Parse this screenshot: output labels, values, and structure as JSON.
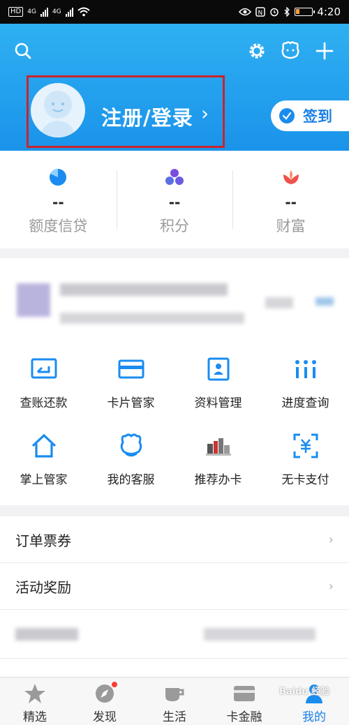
{
  "status_bar": {
    "hd": "HD",
    "net1": "4G",
    "net2": "4G",
    "time": "4:20"
  },
  "header": {
    "login_text": "注册/登录",
    "chevron": "›",
    "checkin_label": "签到"
  },
  "stats": [
    {
      "icon": "pie-icon",
      "value": "--",
      "label": "额度信贷"
    },
    {
      "icon": "three-circles-icon",
      "value": "--",
      "label": "积分"
    },
    {
      "icon": "lotus-icon",
      "value": "--",
      "label": "财富"
    }
  ],
  "grid": [
    {
      "icon": "bill-repay-icon",
      "label": "查账还款"
    },
    {
      "icon": "card-icon",
      "label": "卡片管家"
    },
    {
      "icon": "profile-icon",
      "label": "资料管理"
    },
    {
      "icon": "progress-icon",
      "label": "进度查询"
    },
    {
      "icon": "home-icon",
      "label": "掌上管家"
    },
    {
      "icon": "customer-service-icon",
      "label": "我的客服"
    },
    {
      "icon": "recommend-card-icon",
      "label": "推荐办卡"
    },
    {
      "icon": "scan-pay-icon",
      "label": "无卡支付"
    }
  ],
  "list": [
    {
      "label": "订单票券",
      "chevron": "›"
    },
    {
      "label": "活动奖励",
      "chevron": "›"
    }
  ],
  "list_partial": "安全",
  "tabs": [
    {
      "icon": "star-icon",
      "label": "精选"
    },
    {
      "icon": "compass-icon",
      "label": "发现"
    },
    {
      "icon": "cup-icon",
      "label": "生活"
    },
    {
      "icon": "card-tab-icon",
      "label": "卡金融"
    },
    {
      "icon": "person-icon",
      "label": "我的"
    }
  ],
  "watermark": "Baidu 经验",
  "colors": {
    "primary": "#1a8cf0",
    "header_top": "#2fb0f2",
    "highlight_box": "#c9242b"
  }
}
